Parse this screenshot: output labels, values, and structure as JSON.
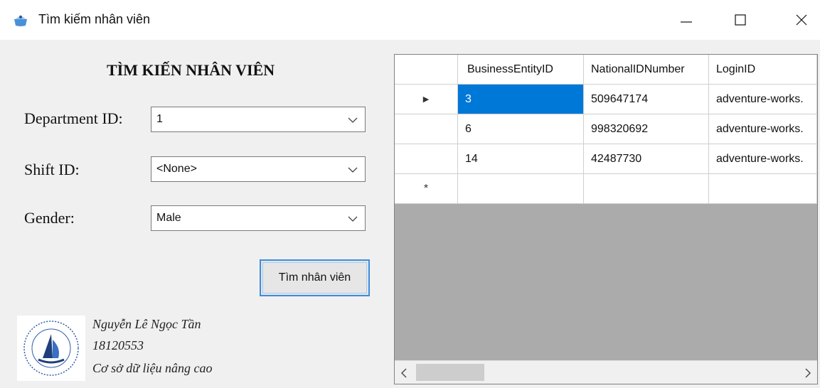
{
  "window": {
    "title": "Tìm kiếm nhân viên",
    "icon": "app-icon",
    "controls": [
      "minimize-icon",
      "maximize-icon",
      "close-icon"
    ]
  },
  "form": {
    "heading": "TÌM KIẾN NHÂN VIÊN",
    "department_label": "Department ID:",
    "department_value": "1",
    "shift_label": "Shift ID:",
    "shift_value": "<None>",
    "gender_label": "Gender:",
    "gender_value": "Male",
    "search_button": "Tìm nhân viên"
  },
  "author": {
    "name": "Nguyễn Lê Ngọc Tần",
    "student_id": "18120553",
    "course": "Cơ sở dữ liệu nâng cao",
    "logo": "university-logo"
  },
  "grid": {
    "columns": [
      "BusinessEntityID",
      "NationalIDNumber",
      "LoginID"
    ],
    "rows": [
      [
        "3",
        "509647174",
        "adventure-works."
      ],
      [
        "6",
        "998320692",
        "adventure-works."
      ],
      [
        "14",
        "42487730",
        "adventure-works."
      ]
    ],
    "current_row_marker": "▶",
    "new_row_marker": "*",
    "selected_cell": [
      0,
      0
    ]
  },
  "colors": {
    "selection": "#0078d7",
    "focus_border": "#3c8ce0",
    "grid_background": "#ababab"
  }
}
